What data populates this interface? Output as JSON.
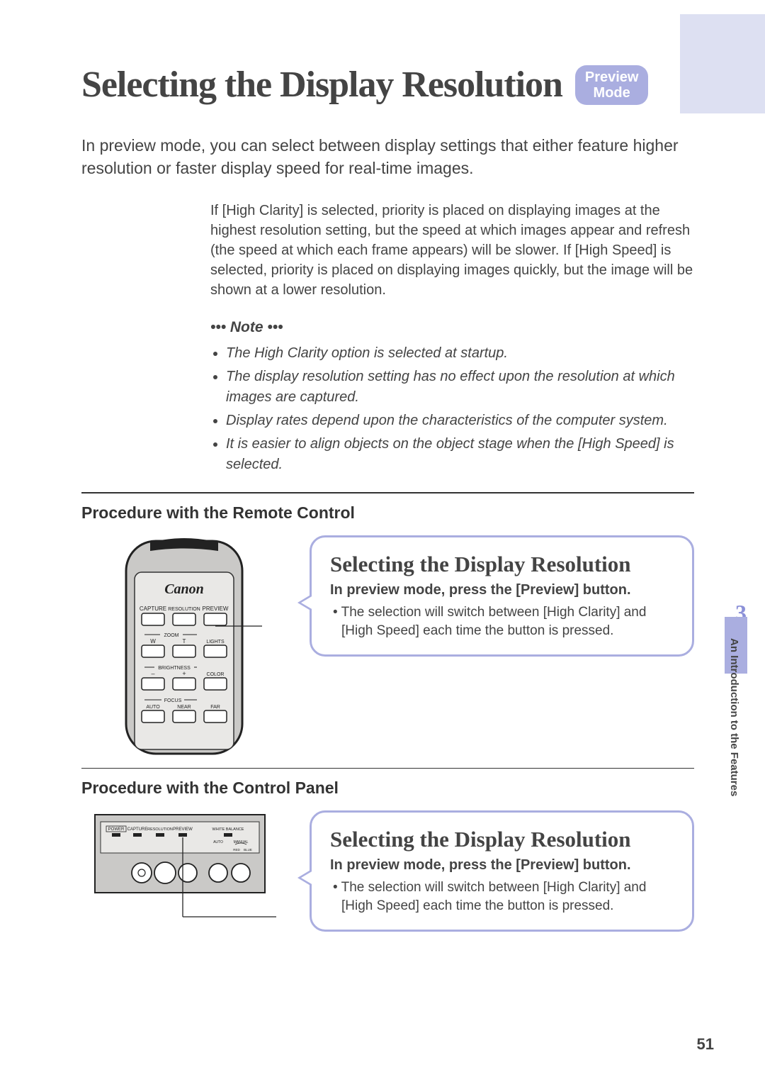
{
  "header": {
    "title": "Selecting the Display Resolution",
    "badge_line1": "Preview",
    "badge_line2": "Mode"
  },
  "intro": "In preview mode, you can select between display settings that either feature higher resolution or faster display speed for real-time images.",
  "detail": "If [High Clarity] is selected, priority is placed on displaying images at the highest resolution setting, but the speed at which images appear and refresh (the speed at which each frame appears) will be slower. If [High Speed] is selected, priority is placed on displaying images quickly, but the image will be shown at a lower resolution.",
  "note": {
    "heading": "••• Note •••",
    "items": [
      "The High Clarity option is selected at startup.",
      "The display resolution setting has no effect upon the resolution at which images are captured.",
      "Display rates depend upon the characteristics of the computer system.",
      "It is easier to align objects on the object stage when the [High Speed] is selected."
    ]
  },
  "section1": {
    "title": "Procedure with the Remote Control",
    "callout": {
      "title": "Selecting the Display Resolution",
      "sub": "In preview mode, press the [Preview] button.",
      "body": "• The selection will switch between [High Clarity] and [High Speed] each time the button is pressed."
    }
  },
  "section2": {
    "title": "Procedure with the Control Panel",
    "callout": {
      "title": "Selecting the Display Resolution",
      "sub": "In preview mode, press the [Preview] button.",
      "body": "• The selection will switch between [High Clarity] and [High Speed] each time the button is pressed."
    }
  },
  "remote": {
    "brand": "Canon",
    "buttons": {
      "capture": "CAPTURE",
      "resolution": "RESOLUTION",
      "preview": "PREVIEW",
      "zoom": "ZOOM",
      "w": "W",
      "t": "T",
      "lights": "LIGHTS",
      "brightness": "BRIGHTNESS",
      "minus": "–",
      "plus": "+",
      "color": "COLOR",
      "focus": "FOCUS",
      "auto": "AUTO",
      "near": "NEAR",
      "far": "FAR"
    }
  },
  "panel": {
    "power": "POWER",
    "capture": "CAPTURE",
    "resolution": "RESOLUTION",
    "preview": "PREVIEW",
    "white_balance": "WHITE BALANCE",
    "auto": "AUTO",
    "manual": "MANUAL",
    "red": "RED",
    "blue": "BLUE"
  },
  "chapter": {
    "number": "3",
    "label": "An Introduction to the Features"
  },
  "page_number": "51"
}
